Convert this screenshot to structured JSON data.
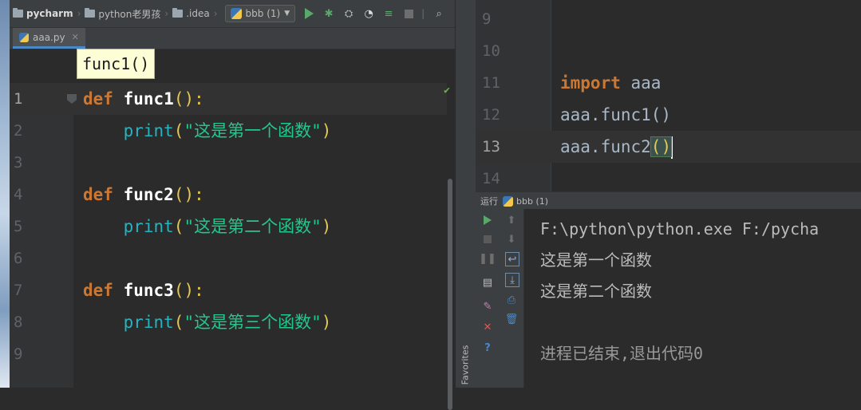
{
  "toolbar": {
    "crumbs": [
      "pycharm",
      "python老男孩",
      ".idea"
    ],
    "run_config": "bbb (1)"
  },
  "tab": {
    "filename": "aaa.py"
  },
  "tooltip": "func1()",
  "editor_lines": [
    {
      "n": "1",
      "kind": "def",
      "kw": "def",
      "name": "func1",
      "tail": "():"
    },
    {
      "n": "2",
      "kind": "print",
      "bi": "print",
      "arg": "\"这是第一个函数\""
    },
    {
      "n": "3",
      "kind": "blank"
    },
    {
      "n": "4",
      "kind": "def",
      "kw": "def",
      "name": "func2",
      "tail": "():"
    },
    {
      "n": "5",
      "kind": "print",
      "bi": "print",
      "arg": "\"这是第二个函数\""
    },
    {
      "n": "6",
      "kind": "blank"
    },
    {
      "n": "7",
      "kind": "def",
      "kw": "def",
      "name": "func3",
      "tail": "():"
    },
    {
      "n": "8",
      "kind": "print",
      "bi": "print",
      "arg": "\"这是第三个函数\""
    },
    {
      "n": "9",
      "kind": "blank"
    }
  ],
  "right_lines": [
    {
      "n": "9",
      "text": ""
    },
    {
      "n": "10",
      "text": ""
    },
    {
      "n": "11",
      "kw": "import",
      "text": " aaa"
    },
    {
      "n": "12",
      "text": "aaa.func1()"
    },
    {
      "n": "13",
      "text": "aaa.func2"
    },
    {
      "n": "14",
      "text": ""
    }
  ],
  "run_panel": {
    "label": "运行",
    "config": "bbb (1)",
    "output": [
      "F:\\python\\python.exe F:/pycha",
      "这是第一个函数",
      "这是第二个函数",
      "",
      "进程已结束,退出代码0"
    ]
  },
  "favorites_label": "Favorites"
}
